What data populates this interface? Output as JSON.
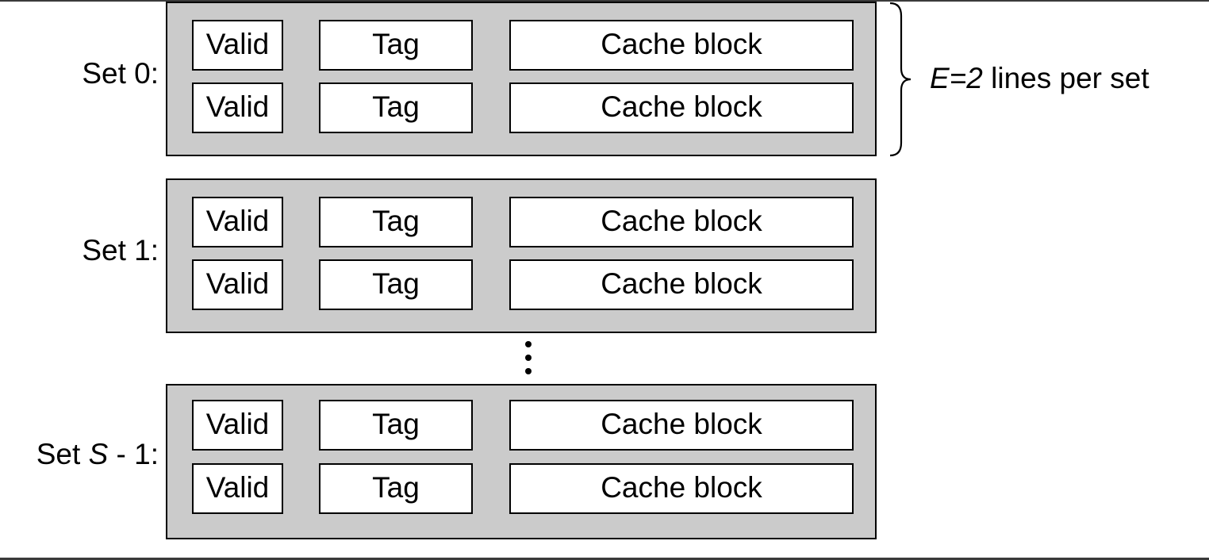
{
  "diagram": {
    "sets": [
      {
        "label_prefix": "Set ",
        "label_var": "",
        "label_suffix": "0:",
        "lines": [
          {
            "valid": "Valid",
            "tag": "Tag",
            "block": "Cache block"
          },
          {
            "valid": "Valid",
            "tag": "Tag",
            "block": "Cache block"
          }
        ]
      },
      {
        "label_prefix": "Set ",
        "label_var": "",
        "label_suffix": "1:",
        "lines": [
          {
            "valid": "Valid",
            "tag": "Tag",
            "block": "Cache block"
          },
          {
            "valid": "Valid",
            "tag": "Tag",
            "block": "Cache block"
          }
        ]
      },
      {
        "label_prefix": "Set ",
        "label_var": "S",
        "label_suffix": " - 1:",
        "lines": [
          {
            "valid": "Valid",
            "tag": "Tag",
            "block": "Cache block"
          },
          {
            "valid": "Valid",
            "tag": "Tag",
            "block": "Cache block"
          }
        ]
      }
    ],
    "ellipsis": "vertical-ellipsis",
    "annotation": {
      "var": "E=2",
      "text": " lines per set"
    },
    "colors": {
      "set_fill": "#cbcbcb",
      "cell_fill": "#ffffff",
      "stroke": "#000000"
    }
  }
}
